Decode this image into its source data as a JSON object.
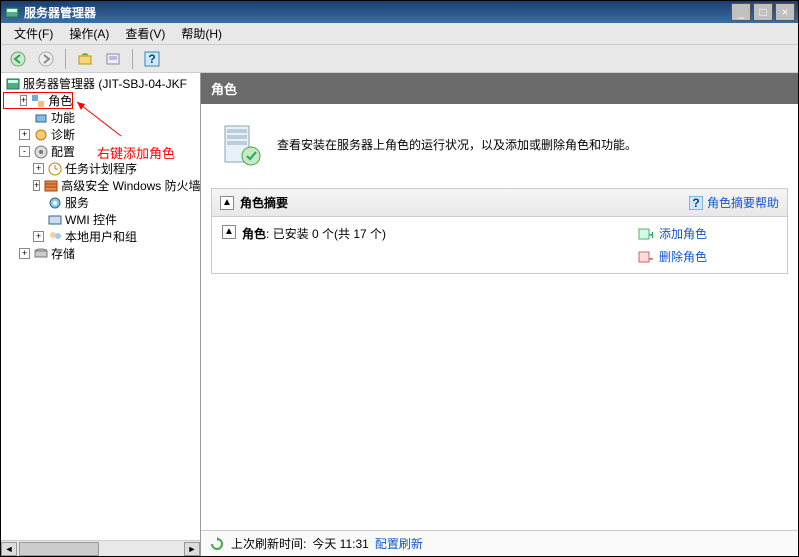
{
  "window": {
    "title": "服务器管理器",
    "min": "_",
    "max": "□",
    "close": "×"
  },
  "menu": {
    "file": "文件(F)",
    "action": "操作(A)",
    "view": "查看(V)",
    "help": "帮助(H)"
  },
  "toolbar": {
    "back": "◄",
    "forward": "►"
  },
  "tree": {
    "root": "服务器管理器 (JIT-SBJ-04-JKF",
    "roles": "角色",
    "features": "功能",
    "diagnostics": "诊断",
    "configuration": "配置",
    "task_scheduler": "任务计划程序",
    "advanced_firewall": "高级安全 Windows 防火墙",
    "services": "服务",
    "wmi_control": "WMI 控件",
    "local_users": "本地用户和组",
    "storage": "存储"
  },
  "annotation": {
    "text": "右键添加角色"
  },
  "right": {
    "header": "角色",
    "banner_text": "查看安装在服务器上角色的运行状况，以及添加或删除角色和功能。",
    "panel_title": "角色摘要",
    "panel_help": "角色摘要帮助",
    "collapse_glyph": "▲",
    "roles_label": "角色",
    "roles_count_text": "已安装 0 个(共 17 个)",
    "add_roles": "添加角色",
    "remove_roles": "删除角色"
  },
  "status": {
    "last_refresh_label": "上次刷新时间:",
    "last_refresh_time": "今天 11:31",
    "config_refresh": "配置刷新"
  }
}
